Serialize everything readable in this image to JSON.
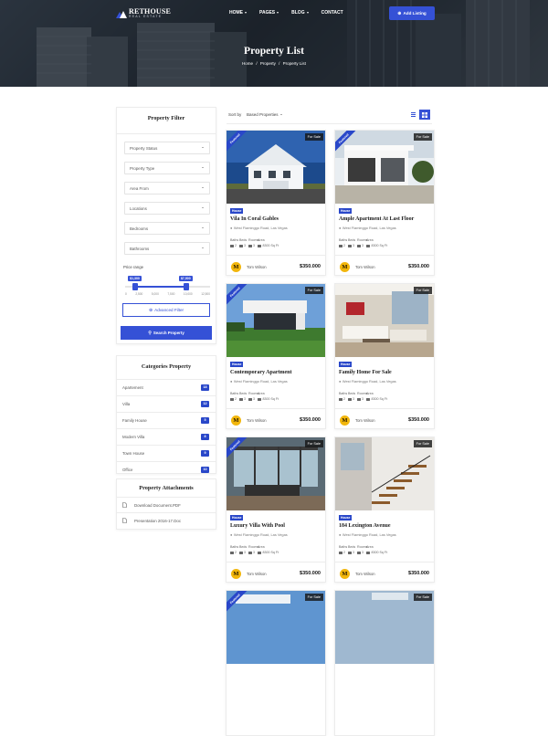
{
  "brand": {
    "name": "RETHOUSE",
    "tagline": "REAL ESTATE",
    "accent": "#3551d6"
  },
  "nav": {
    "items": [
      "HOME",
      "PAGES",
      "BLOG",
      "CONTACT"
    ],
    "add_listing": "Add Listing"
  },
  "hero": {
    "title": "Property List",
    "breadcrumb": [
      "Home",
      "Property",
      "Property List"
    ],
    "sep": "/"
  },
  "filter": {
    "title": "Property Filter",
    "selects": [
      "Property Status",
      "Property Type",
      "Area From",
      "Locations",
      "Bedrooms",
      "Bathrooms"
    ],
    "price_label": "Price range",
    "price_min": "$1,300",
    "price_max": "$7,500",
    "price_min_frac": 0.12,
    "price_max_frac": 0.72,
    "ticks": [
      "0",
      "2,500",
      "5,000",
      "7,500",
      "10,000",
      "12,500"
    ],
    "advanced": "Advanced Filter",
    "search": "Search Property"
  },
  "categories": {
    "title": "Categories Property",
    "items": [
      {
        "label": "Apartement",
        "count": "18"
      },
      {
        "label": "Villa",
        "count": "12"
      },
      {
        "label": "Family House",
        "count": "5"
      },
      {
        "label": "Modern Villa",
        "count": "8"
      },
      {
        "label": "Town House",
        "count": "9"
      },
      {
        "label": "Office",
        "count": "10"
      }
    ]
  },
  "attachments": {
    "title": "Property Attachments",
    "items": [
      "Download Document.PDF",
      "Presentation 2016-17.Doc"
    ]
  },
  "sort": {
    "label": "Sort by",
    "value": "Based Properties"
  },
  "card_labels": {
    "featured": "Featured",
    "baths": "Baths",
    "beds": "Beds",
    "rooms": "Rooms",
    "area": "Area",
    "agent_initial": "M"
  },
  "listings": [
    {
      "title": "Vila In Coral Gables",
      "status": "For Sale",
      "type": "House",
      "address": "West Flaminggo Road, Las Vegas",
      "baths": "2",
      "beds": "3",
      "rooms": "3",
      "area": "8300 Sq Ft",
      "agent": "Tom Wilson",
      "price": "$350.000",
      "featured": true,
      "scene": "white-house"
    },
    {
      "title": "Ample Apartment At Last Floor",
      "status": "For Sale",
      "type": "House",
      "address": "West Flaminggo Road, Las Vegas",
      "baths": "2",
      "beds": "3",
      "rooms": "3",
      "area": "8300 Sq Ft",
      "agent": "Tom Wilson",
      "price": "$350.000",
      "featured": true,
      "scene": "modern-white"
    },
    {
      "title": "Contemporary Apartment",
      "status": "For Sale",
      "type": "House",
      "address": "West Flaminggo Road, Las Vegas",
      "baths": "2",
      "beds": "3",
      "rooms": "3",
      "area": "8300 Sq Ft",
      "agent": "Tom Wilson",
      "price": "$350.000",
      "featured": true,
      "scene": "contemporary"
    },
    {
      "title": "Family Home For Sale",
      "status": "For Sale",
      "type": "House",
      "address": "West Flaminggo Road, Las Vegas",
      "baths": "2",
      "beds": "3",
      "rooms": "3",
      "area": "8300 Sq Ft",
      "agent": "Tom Wilson",
      "price": "$350.000",
      "featured": false,
      "scene": "living-room"
    },
    {
      "title": "Luxury Villa With Pool",
      "status": "For Sale",
      "type": "House",
      "address": "West Flaminggo Road, Las Vegas",
      "baths": "2",
      "beds": "3",
      "rooms": "3",
      "area": "8300 Sq Ft",
      "agent": "Tom Wilson",
      "price": "$350.000",
      "featured": true,
      "scene": "interior"
    },
    {
      "title": "184 Lexington Avenue",
      "status": "For Sale",
      "type": "House",
      "address": "West Flaminggo Road, Las Vegas",
      "baths": "2",
      "beds": "3",
      "rooms": "3",
      "area": "8300 Sq Ft",
      "agent": "Tom Wilson",
      "price": "$350.000",
      "featured": false,
      "scene": "staircase"
    },
    {
      "title": "",
      "status": "For Sale",
      "type": "",
      "address": "",
      "baths": "",
      "beds": "",
      "rooms": "",
      "area": "",
      "agent": "",
      "price": "",
      "featured": true,
      "scene": "sky"
    },
    {
      "title": "",
      "status": "For Sale",
      "type": "",
      "address": "",
      "baths": "",
      "beds": "",
      "rooms": "",
      "area": "",
      "agent": "",
      "price": "",
      "featured": false,
      "scene": "sky2"
    }
  ]
}
